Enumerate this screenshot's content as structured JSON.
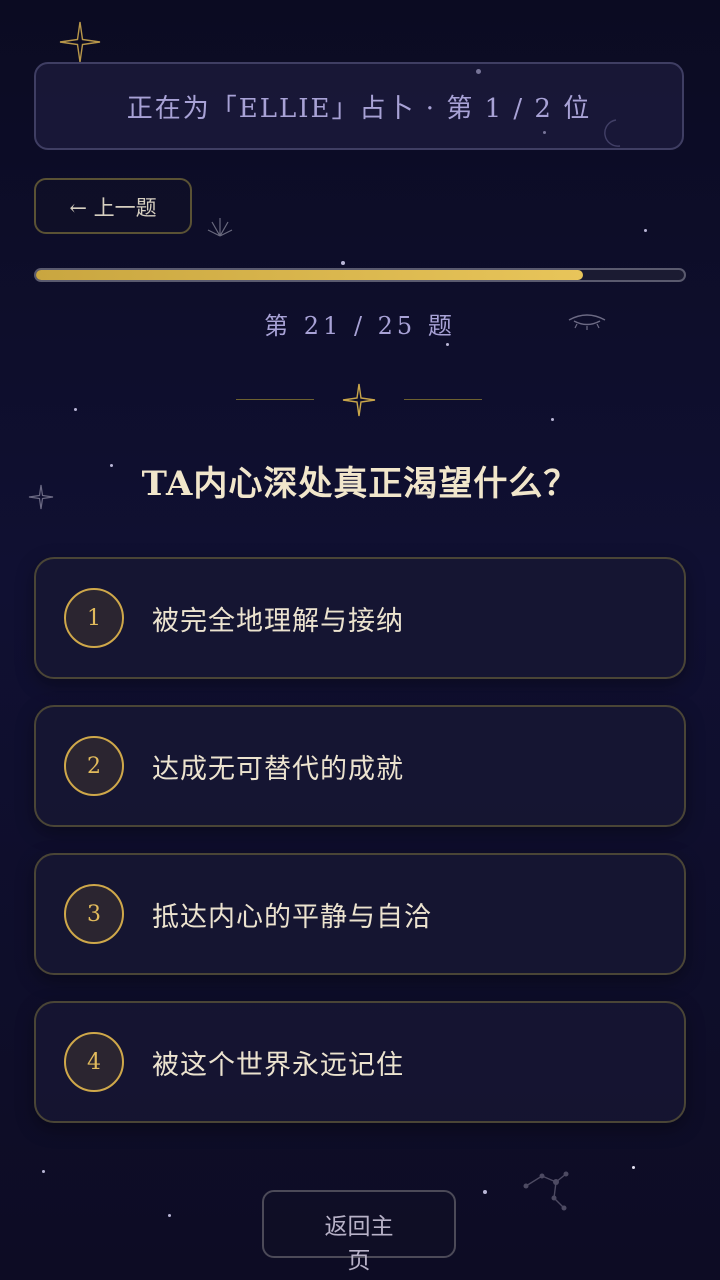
{
  "header": {
    "reading_label": "正在为「ELLIE」占卜 · 第 1 / 2 位"
  },
  "nav": {
    "prev_label": "← 上一题",
    "home_label": "返回主页"
  },
  "progress": {
    "fraction": 0.844,
    "counter_text": "第 21 / 25 题"
  },
  "question": {
    "title": "TA内心深处真正渴望什么？",
    "options": [
      {
        "number": "1",
        "text": "被完全地理解与接纳"
      },
      {
        "number": "2",
        "text": "达成无可替代的成就"
      },
      {
        "number": "3",
        "text": "抵达内心的平静与自洽"
      },
      {
        "number": "4",
        "text": "被这个世界永远记住"
      }
    ]
  },
  "colors": {
    "accent_gold": "#e2bb5c",
    "label_lavender": "#a8a2d6",
    "background": "#0d0c26"
  }
}
